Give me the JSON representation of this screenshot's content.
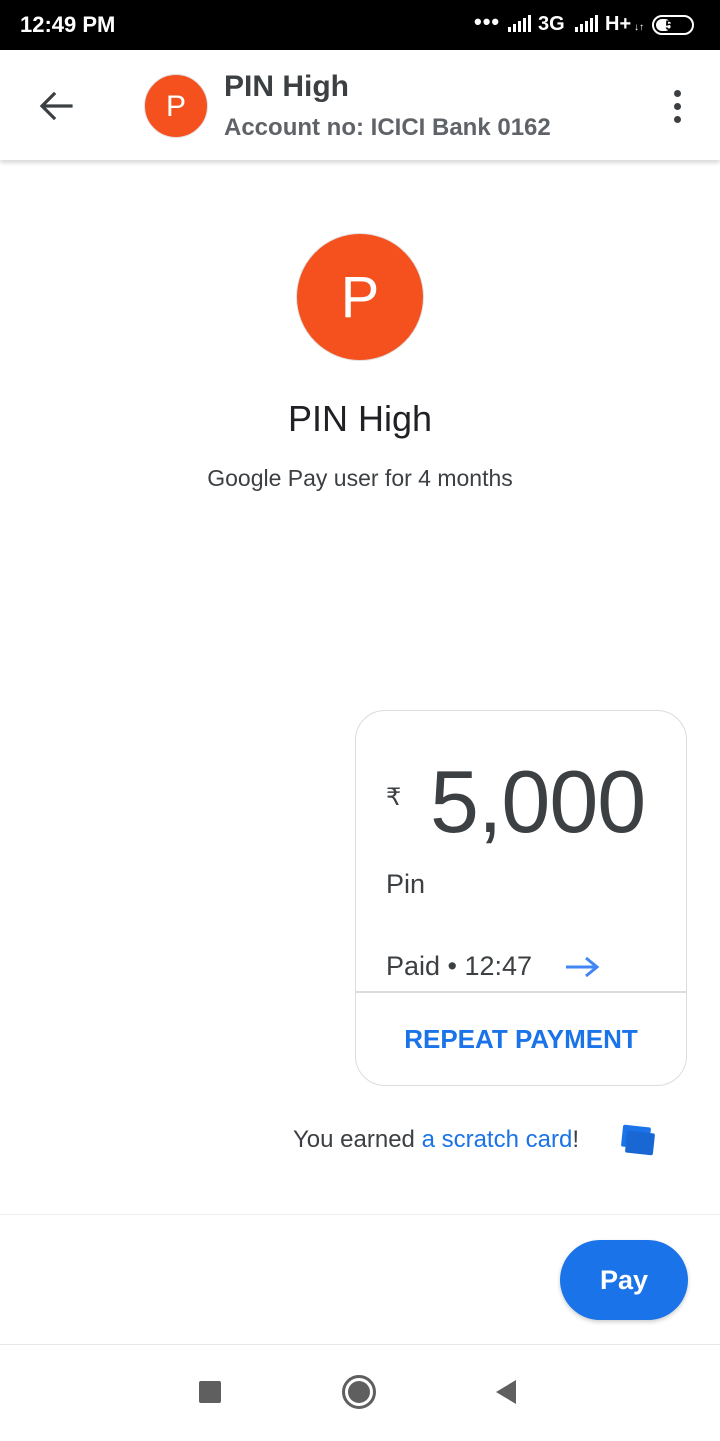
{
  "status_bar": {
    "time": "12:49 PM",
    "dots": "•••",
    "network_1": "3G",
    "network_2": "H+",
    "network_2_sub": "↓↑",
    "battery": "51",
    "battery_level": 0.51
  },
  "header": {
    "avatar_initial": "P",
    "name": "PIN High",
    "account": "Account no: ICICI Bank 0162",
    "avatar_color": "#f4511e"
  },
  "profile": {
    "avatar_initial": "P",
    "name": "PIN High",
    "subtitle": "Google Pay user for 4 months"
  },
  "payment_card": {
    "currency": "₹",
    "amount": "5,000",
    "note": "Pin",
    "status": "Paid • 12:47",
    "repeat_label": "REPEAT PAYMENT"
  },
  "reward": {
    "prefix": "You earned ",
    "link": "a scratch card",
    "suffix": "!"
  },
  "actions": {
    "pay_label": "Pay"
  },
  "icons": {
    "back": "arrow-back-icon",
    "more": "more-vert-icon",
    "status_arrow": "arrow-forward-icon",
    "scratch": "scratch-card-icon",
    "nav_recents": "recents-square-icon",
    "nav_home": "home-circle-icon",
    "nav_back": "back-triangle-icon"
  },
  "colors": {
    "accent": "#1a73e8",
    "avatar": "#f4511e",
    "text_primary": "#202124",
    "text_secondary": "#3c4043"
  }
}
